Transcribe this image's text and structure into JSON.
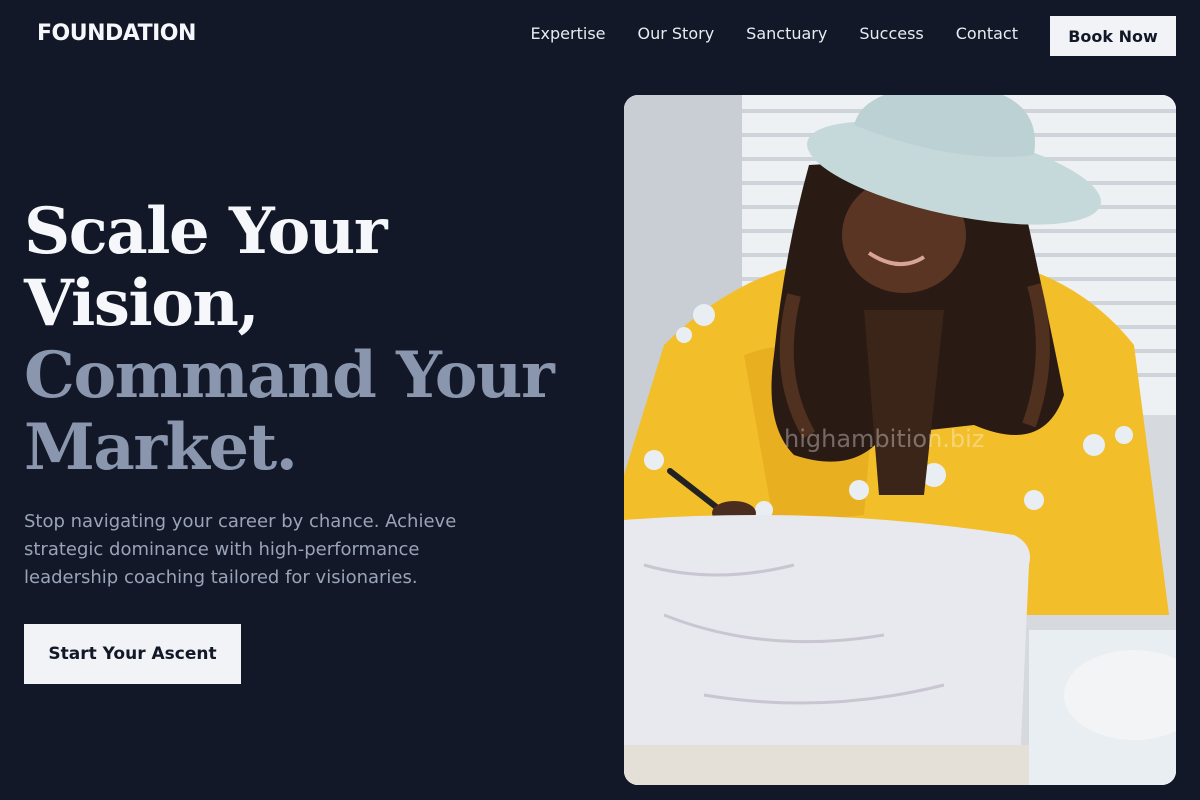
{
  "header": {
    "brand": "FOUNDATION",
    "nav": [
      "Expertise",
      "Our Story",
      "Sanctuary",
      "Success",
      "Contact"
    ],
    "book_label": "Book Now"
  },
  "hero": {
    "title_line1": "Scale Your Vision,",
    "title_line2": "Command Your Market.",
    "subtitle": "Stop navigating your career by chance. Achieve strategic dominance with high-performance leadership coaching tailored for visionaries.",
    "cta_label": "Start Your Ascent"
  },
  "image": {
    "watermark": "highambition.biz"
  },
  "colors": {
    "background": "#121827",
    "muted_heading": "#8a96ad",
    "button_bg": "#f1f3f7"
  }
}
